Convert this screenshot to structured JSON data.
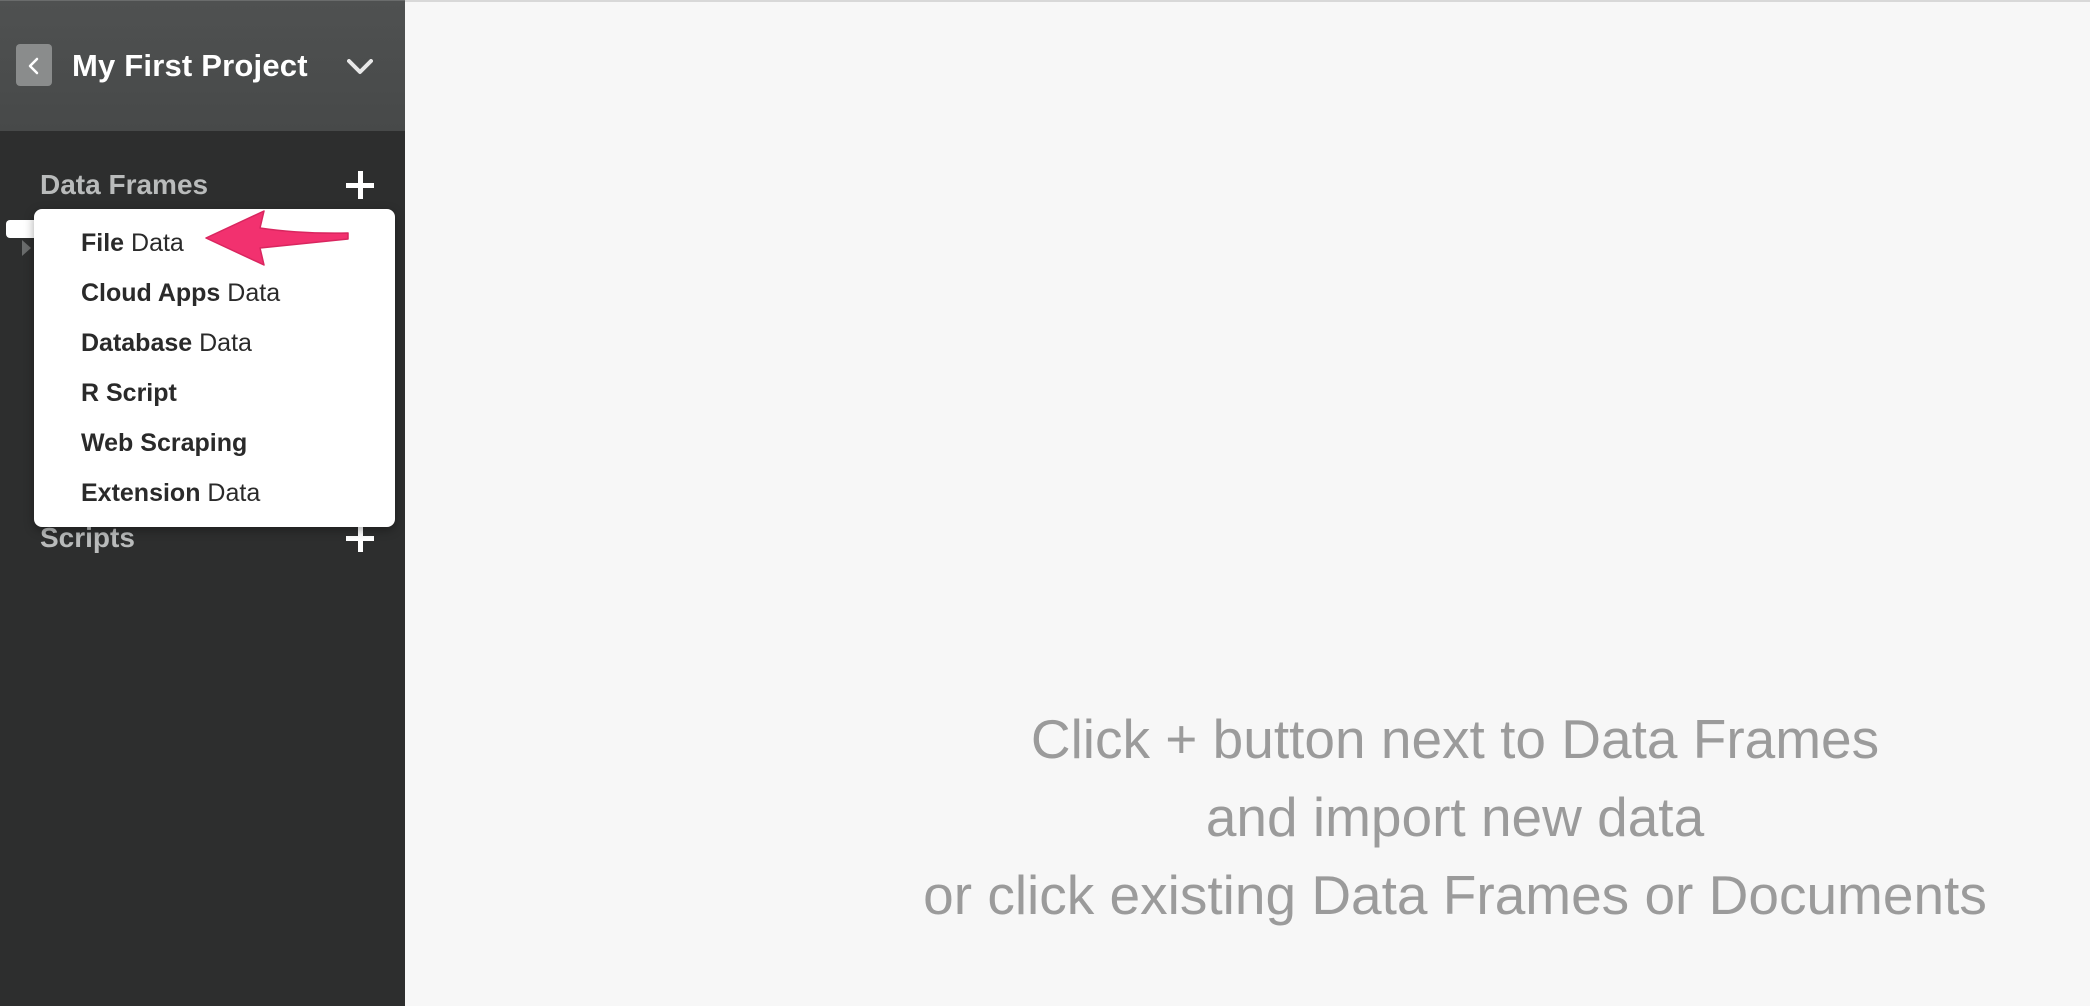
{
  "project": {
    "title": "My First Project",
    "back_icon": "chevron-left-icon",
    "menu_icon": "chevron-down-icon"
  },
  "sidebar": {
    "data_frames_label": "Data Frames",
    "scripts_label": "Scripts",
    "add_icon": "plus-icon"
  },
  "add_data_menu": {
    "items": [
      {
        "bold": "File",
        "rest": " Data"
      },
      {
        "bold": "Cloud Apps",
        "rest": " Data"
      },
      {
        "bold": "Database",
        "rest": " Data"
      },
      {
        "bold": "R Script",
        "rest": ""
      },
      {
        "bold": "Web Scraping",
        "rest": ""
      },
      {
        "bold": "Extension",
        "rest": " Data"
      }
    ]
  },
  "main": {
    "hint_lines": [
      "Click + button next to Data Frames",
      "and import new data",
      "or click existing Data Frames or Documents"
    ]
  },
  "colors": {
    "sidebar_bg": "#2d2e2e",
    "header_bg": "#4b4d4d",
    "main_bg": "#f7f7f7",
    "annotation_arrow": "#f2316f",
    "hint_text": "#9b9b9b"
  }
}
